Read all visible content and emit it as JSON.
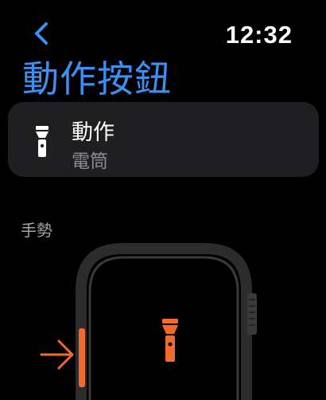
{
  "status_bar": {
    "time": "12:32"
  },
  "header": {
    "title": "動作按鈕"
  },
  "action": {
    "label": "動作",
    "value": "電筒",
    "icon": "flashlight-icon"
  },
  "gesture": {
    "section_label": "手勢",
    "illustration_icon": "flashlight-icon",
    "arrow_icon": "arrow-right-icon"
  },
  "colors": {
    "accent": "#3d8ff0",
    "action_button": "#f36b2c",
    "card_bg": "#1f1f21"
  }
}
